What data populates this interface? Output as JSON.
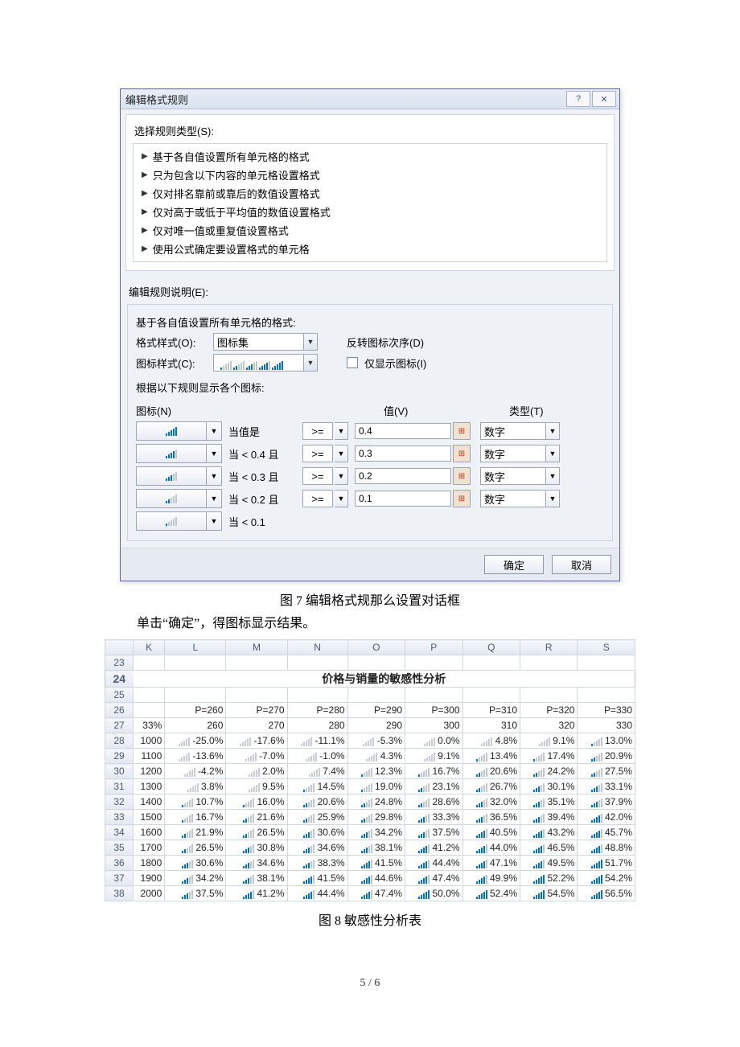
{
  "dialog": {
    "title": "编辑格式规则",
    "ruleTypeLabel": "选择规则类型(S):",
    "ruleTypes": [
      "基于各自值设置所有单元格的格式",
      "只为包含以下内容的单元格设置格式",
      "仅对排名靠前或靠后的数值设置格式",
      "仅对高于或低于平均值的数值设置格式",
      "仅对唯一值或重复值设置格式",
      "使用公式确定要设置格式的单元格"
    ],
    "editDescLabel": "编辑规则说明(E):",
    "basedOnLabel": "基于各自值设置所有单元格的格式:",
    "formatStyleLabel": "格式样式(O):",
    "formatStyleValue": "图标集",
    "reverseOrderLabel": "反转图标次序(D)",
    "iconStyleLabel": "图标样式(C):",
    "showIconOnlyLabel": "仅显示图标(I)",
    "rulesIntro": "根据以下规则显示各个图标:",
    "hdrIcon": "图标(N)",
    "hdrValue": "值(V)",
    "hdrType": "类型(T)",
    "rules": [
      {
        "level": 5,
        "cond": "当值是",
        "op": ">=",
        "val": "0.4",
        "type": "数字"
      },
      {
        "level": 4,
        "cond": "当 < 0.4 且",
        "op": ">=",
        "val": "0.3",
        "type": "数字"
      },
      {
        "level": 3,
        "cond": "当 < 0.3 且",
        "op": ">=",
        "val": "0.2",
        "type": "数字"
      },
      {
        "level": 2,
        "cond": "当 < 0.2 且",
        "op": ">=",
        "val": "0.1",
        "type": "数字"
      },
      {
        "level": 1,
        "cond": "当 < 0.1",
        "op": "",
        "val": "",
        "type": ""
      }
    ],
    "okLabel": "确定",
    "cancelLabel": "取消"
  },
  "caption1": "图 7  编辑格式规那么设置对话框",
  "bodyText": "单击“确定”，得图标显示结果。",
  "sheet": {
    "colHeaders": [
      "",
      "K",
      "L",
      "M",
      "N",
      "O",
      "P",
      "Q",
      "R",
      "S"
    ],
    "title": "价格与销量的敏感性分析",
    "titleRow": 24,
    "headerRow": {
      "row": 26,
      "cells": [
        "",
        "P=260",
        "P=270",
        "P=280",
        "P=290",
        "P=300",
        "P=310",
        "P=320",
        "P=330"
      ]
    },
    "subHeaderRow": {
      "row": 27,
      "cells": [
        "33%",
        "260",
        "270",
        "280",
        "290",
        "300",
        "310",
        "320",
        "330"
      ]
    },
    "dataRows": [
      {
        "row": 28,
        "label": "1000",
        "values": [
          "-25.0%",
          "-17.6%",
          "-11.1%",
          "-5.3%",
          "0.0%",
          "4.8%",
          "9.1%",
          "13.0%"
        ],
        "levels": [
          0,
          0,
          0,
          0,
          0,
          0,
          0,
          1
        ]
      },
      {
        "row": 29,
        "label": "1100",
        "values": [
          "-13.6%",
          "-7.0%",
          "-1.0%",
          "4.3%",
          "9.1%",
          "13.4%",
          "17.4%",
          "20.9%"
        ],
        "levels": [
          0,
          0,
          0,
          0,
          0,
          1,
          1,
          2
        ]
      },
      {
        "row": 30,
        "label": "1200",
        "values": [
          "-4.2%",
          "2.0%",
          "7.4%",
          "12.3%",
          "16.7%",
          "20.6%",
          "24.2%",
          "27.5%"
        ],
        "levels": [
          0,
          0,
          0,
          1,
          1,
          2,
          2,
          2
        ]
      },
      {
        "row": 31,
        "label": "1300",
        "values": [
          "3.8%",
          "9.5%",
          "14.5%",
          "19.0%",
          "23.1%",
          "26.7%",
          "30.1%",
          "33.1%"
        ],
        "levels": [
          0,
          0,
          1,
          1,
          2,
          2,
          3,
          3
        ]
      },
      {
        "row": 32,
        "label": "1400",
        "values": [
          "10.7%",
          "16.0%",
          "20.6%",
          "24.8%",
          "28.6%",
          "32.0%",
          "35.1%",
          "37.9%"
        ],
        "levels": [
          1,
          1,
          2,
          2,
          2,
          3,
          3,
          3
        ]
      },
      {
        "row": 33,
        "label": "1500",
        "values": [
          "16.7%",
          "21.6%",
          "25.9%",
          "29.8%",
          "33.3%",
          "36.5%",
          "39.4%",
          "42.0%"
        ],
        "levels": [
          1,
          2,
          2,
          2,
          3,
          3,
          3,
          4
        ]
      },
      {
        "row": 34,
        "label": "1600",
        "values": [
          "21.9%",
          "26.5%",
          "30.6%",
          "34.2%",
          "37.5%",
          "40.5%",
          "43.2%",
          "45.7%"
        ],
        "levels": [
          2,
          2,
          3,
          3,
          3,
          4,
          4,
          4
        ]
      },
      {
        "row": 35,
        "label": "1700",
        "values": [
          "26.5%",
          "30.8%",
          "34.6%",
          "38.1%",
          "41.2%",
          "44.0%",
          "46.5%",
          "48.8%"
        ],
        "levels": [
          2,
          3,
          3,
          3,
          4,
          4,
          4,
          4
        ]
      },
      {
        "row": 36,
        "label": "1800",
        "values": [
          "30.6%",
          "34.6%",
          "38.3%",
          "41.5%",
          "44.4%",
          "47.1%",
          "49.5%",
          "51.7%"
        ],
        "levels": [
          3,
          3,
          3,
          4,
          4,
          4,
          4,
          5
        ]
      },
      {
        "row": 37,
        "label": "1900",
        "values": [
          "34.2%",
          "38.1%",
          "41.5%",
          "44.6%",
          "47.4%",
          "49.9%",
          "52.2%",
          "54.2%"
        ],
        "levels": [
          3,
          3,
          4,
          4,
          4,
          4,
          5,
          5
        ]
      },
      {
        "row": 38,
        "label": "2000",
        "values": [
          "37.5%",
          "41.2%",
          "44.4%",
          "47.4%",
          "50.0%",
          "52.4%",
          "54.5%",
          "56.5%"
        ],
        "levels": [
          3,
          4,
          4,
          4,
          5,
          5,
          5,
          5
        ]
      }
    ],
    "emptyRows": [
      23,
      25
    ]
  },
  "caption2": "图 8  敏感性分析表",
  "pageNum": "5 / 6"
}
